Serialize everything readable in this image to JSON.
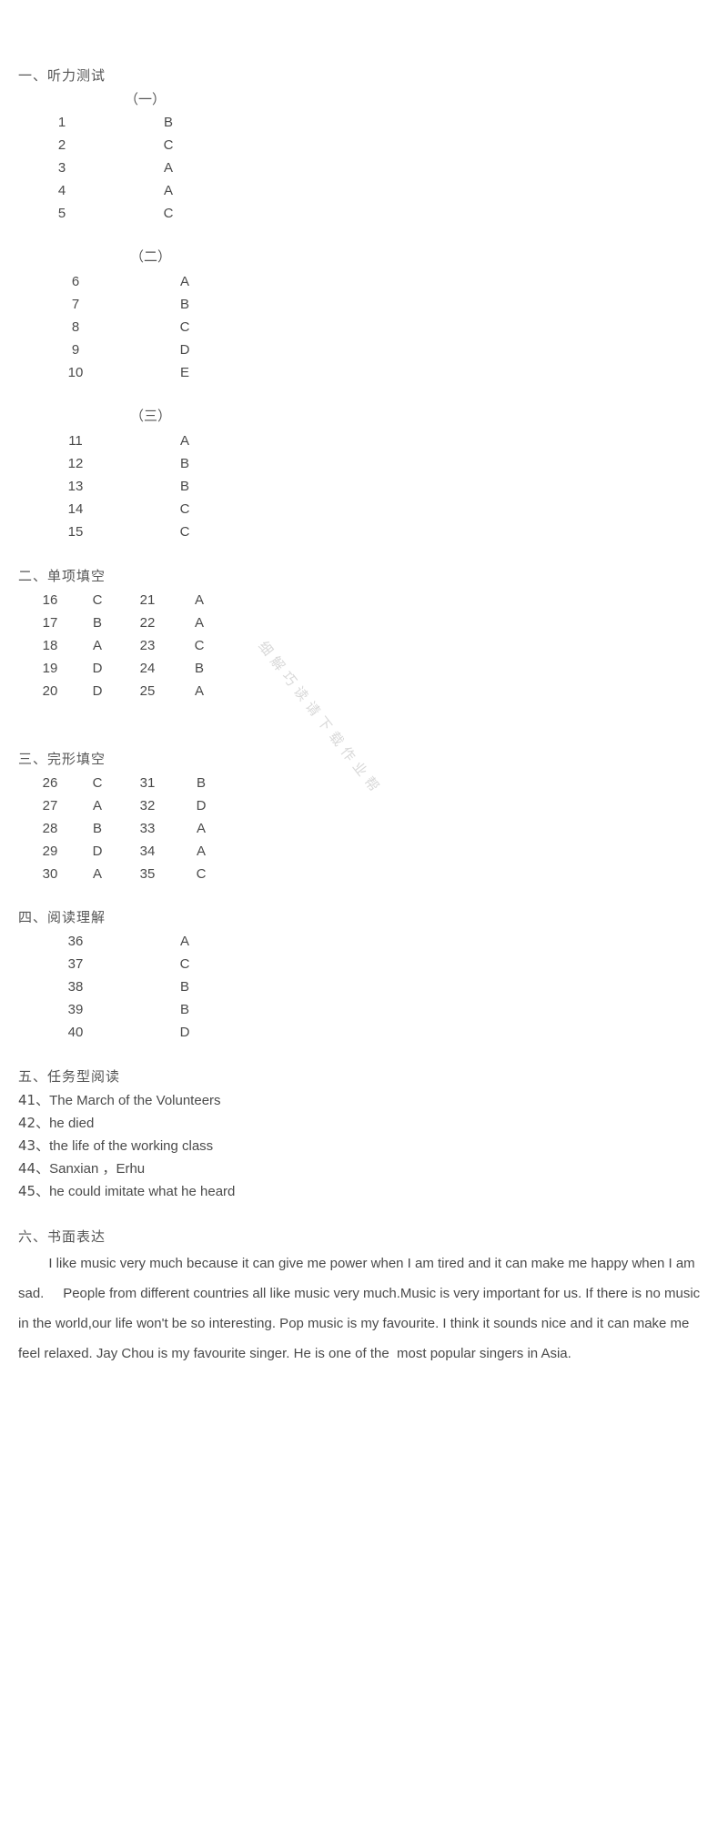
{
  "document": {
    "watermark": "细解巧读请下载作业帮"
  },
  "sections": {
    "listening": {
      "heading": "一、听力测试",
      "parts": [
        {
          "label": "（一）",
          "rows": [
            {
              "number": "1",
              "answer": "B"
            },
            {
              "number": "2",
              "answer": "C"
            },
            {
              "number": "3",
              "answer": "A"
            },
            {
              "number": "4",
              "answer": "A"
            },
            {
              "number": "5",
              "answer": "C"
            }
          ]
        },
        {
          "label": "（二）",
          "rows": [
            {
              "number": "6",
              "answer": "A"
            },
            {
              "number": "7",
              "answer": "B"
            },
            {
              "number": "8",
              "answer": "C"
            },
            {
              "number": "9",
              "answer": "D"
            },
            {
              "number": "10",
              "answer": "E"
            }
          ]
        },
        {
          "label": "（三）",
          "rows": [
            {
              "number": "11",
              "answer": "A"
            },
            {
              "number": "12",
              "answer": "B"
            },
            {
              "number": "13",
              "answer": "B"
            },
            {
              "number": "14",
              "answer": "C"
            },
            {
              "number": "15",
              "answer": "C"
            }
          ]
        }
      ]
    },
    "multiple_choice": {
      "heading": "二、单项填空",
      "rows": [
        {
          "left_number": "16",
          "left_answer": "C",
          "right_number": "21",
          "right_answer": "A"
        },
        {
          "left_number": "17",
          "left_answer": "B",
          "right_number": "22",
          "right_answer": "A"
        },
        {
          "left_number": "18",
          "left_answer": "A",
          "right_number": "23",
          "right_answer": "C"
        },
        {
          "left_number": "19",
          "left_answer": "D",
          "right_number": "24",
          "right_answer": "B"
        },
        {
          "left_number": "20",
          "left_answer": "D",
          "right_number": "25",
          "right_answer": "A"
        }
      ]
    },
    "cloze": {
      "heading": "三、完形填空",
      "rows": [
        {
          "left_number": "26",
          "left_answer": "C",
          "right_number": "31",
          "right_answer": "B"
        },
        {
          "left_number": "27",
          "left_answer": "A",
          "right_number": "32",
          "right_answer": "D"
        },
        {
          "left_number": "28",
          "left_answer": "B",
          "right_number": "33",
          "right_answer": "A"
        },
        {
          "left_number": "29",
          "left_answer": "D",
          "right_number": "34",
          "right_answer": "A"
        },
        {
          "left_number": "30",
          "left_answer": "A",
          "right_number": "35",
          "right_answer": "C"
        }
      ]
    },
    "reading": {
      "heading": "四、阅读理解",
      "rows": [
        {
          "number": "36",
          "answer": "A"
        },
        {
          "number": "37",
          "answer": "C"
        },
        {
          "number": "38",
          "answer": "B"
        },
        {
          "number": "39",
          "answer": "B"
        },
        {
          "number": "40",
          "answer": "D"
        }
      ]
    },
    "task_reading": {
      "heading": "五、任务型阅读",
      "rows": [
        {
          "number": "41、",
          "text": "The March of the Volunteers"
        },
        {
          "number": "42、",
          "text": "he died"
        },
        {
          "number": "43、",
          "text": "the life of the working class"
        },
        {
          "number": "44、",
          "text": "Sanxian ，Erhu"
        },
        {
          "number": "45、",
          "text": "he could imitate what he heard"
        }
      ]
    },
    "writing": {
      "heading": "六、书面表达",
      "essay": "        I like music very much because it can give me power when I am tired and it can make me happy when I am sad.     People from different countries all like music very much.Music is very important for us. If there is no music in the world,our life won't be so interesting. Pop music is my favourite. I think it sounds nice and it can make me feel relaxed. Jay Chou is my favourite singer. He is one of the  most popular singers in Asia."
    }
  }
}
